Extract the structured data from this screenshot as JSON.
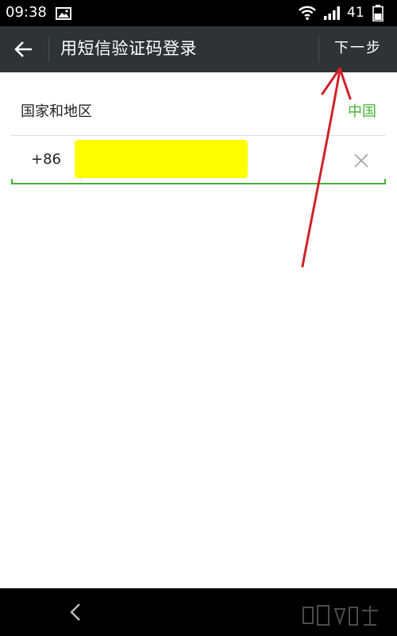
{
  "status_bar": {
    "time": "09:38",
    "battery": "41",
    "icons": [
      "gallery-icon",
      "wifi-icon",
      "signal-icon",
      "battery-icon"
    ]
  },
  "header": {
    "title": "用短信验证码登录",
    "next_label": "下一步",
    "back_icon": "arrow-left-icon"
  },
  "form": {
    "region_label": "国家和地区",
    "region_value": "中国",
    "country_code": "+86",
    "phone_value": "",
    "clear_icon": "close-icon"
  },
  "nav_bar": {
    "back_icon": "chevron-left-icon"
  },
  "colors": {
    "status_bar_bg": "#000000",
    "action_bar_bg": "#2f3336",
    "accent_green": "#45b035",
    "redaction_yellow": "#ffff00",
    "annotation_red": "#d0222a",
    "page_bg": "#ffffff"
  }
}
